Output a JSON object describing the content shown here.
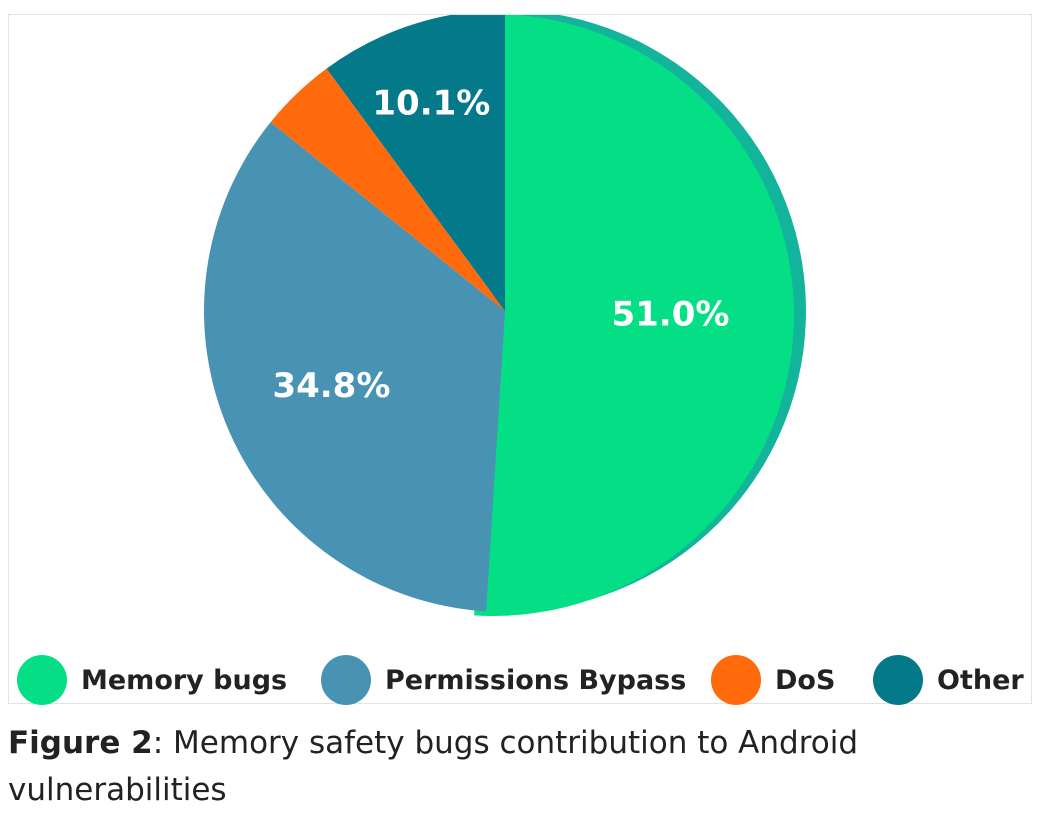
{
  "chart_data": {
    "type": "pie",
    "categories": [
      "Memory bugs",
      "Permissions Bypass",
      "DoS",
      "Other"
    ],
    "values": [
      51.0,
      34.8,
      4.1,
      10.1
    ],
    "data_labels": [
      "51.0%",
      "34.8%",
      "",
      "10.1%"
    ],
    "colors": [
      "#04df86",
      "#4892b3",
      "#ff6a0c",
      "#04798a"
    ],
    "legend_position": "bottom",
    "start_angle": "12 o'clock",
    "direction": "clockwise"
  },
  "caption": {
    "label": "Figure 2",
    "text": ": Memory safety bugs contribution to Android vulnerabilities"
  }
}
